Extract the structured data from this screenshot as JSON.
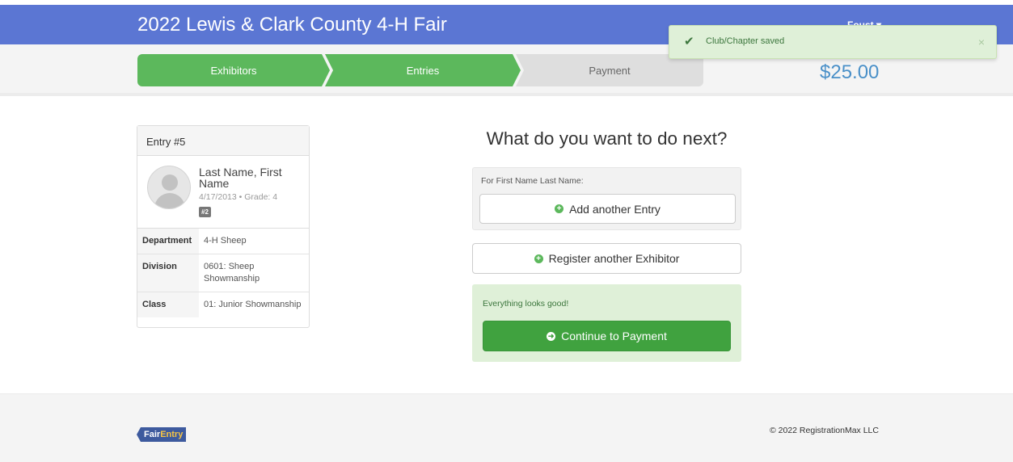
{
  "header": {
    "title": "2022 Lewis & Clark County 4-H Fair",
    "user_menu": "Foust ▾"
  },
  "steps": [
    {
      "label": "Exhibitors",
      "state": "complete"
    },
    {
      "label": "Entries",
      "state": "complete"
    },
    {
      "label": "Payment",
      "state": "pending"
    }
  ],
  "cart_total": "$25.00",
  "toast": {
    "icon": "check-icon",
    "message": "Club/Chapter saved",
    "close": "×"
  },
  "entry_card": {
    "title": "Entry #5",
    "name": "Last Name, First Name",
    "meta": "4/17/2013 • Grade: 4",
    "badge": "#2",
    "rows": [
      {
        "label": "Department",
        "value": "4-H Sheep"
      },
      {
        "label": "Division",
        "value": "0601: Sheep Showmanship"
      },
      {
        "label": "Class",
        "value": "01: Junior Showmanship"
      }
    ]
  },
  "next_steps": {
    "heading": "What do you want to do next?",
    "for_label": "For First Name Last Name:",
    "add_entry": "Add another Entry",
    "register_exhibitor": "Register another Exhibitor",
    "status": "Everything looks good!",
    "continue": "Continue to Payment"
  },
  "footer": {
    "logo_part1": "Fair",
    "logo_part2": "Entry",
    "copyright": "© 2022 RegistrationMax LLC"
  },
  "colors": {
    "nav": "#5b76d3",
    "success": "#5cb85c",
    "primary_button": "#40a23f",
    "total": "#4a90c8"
  }
}
